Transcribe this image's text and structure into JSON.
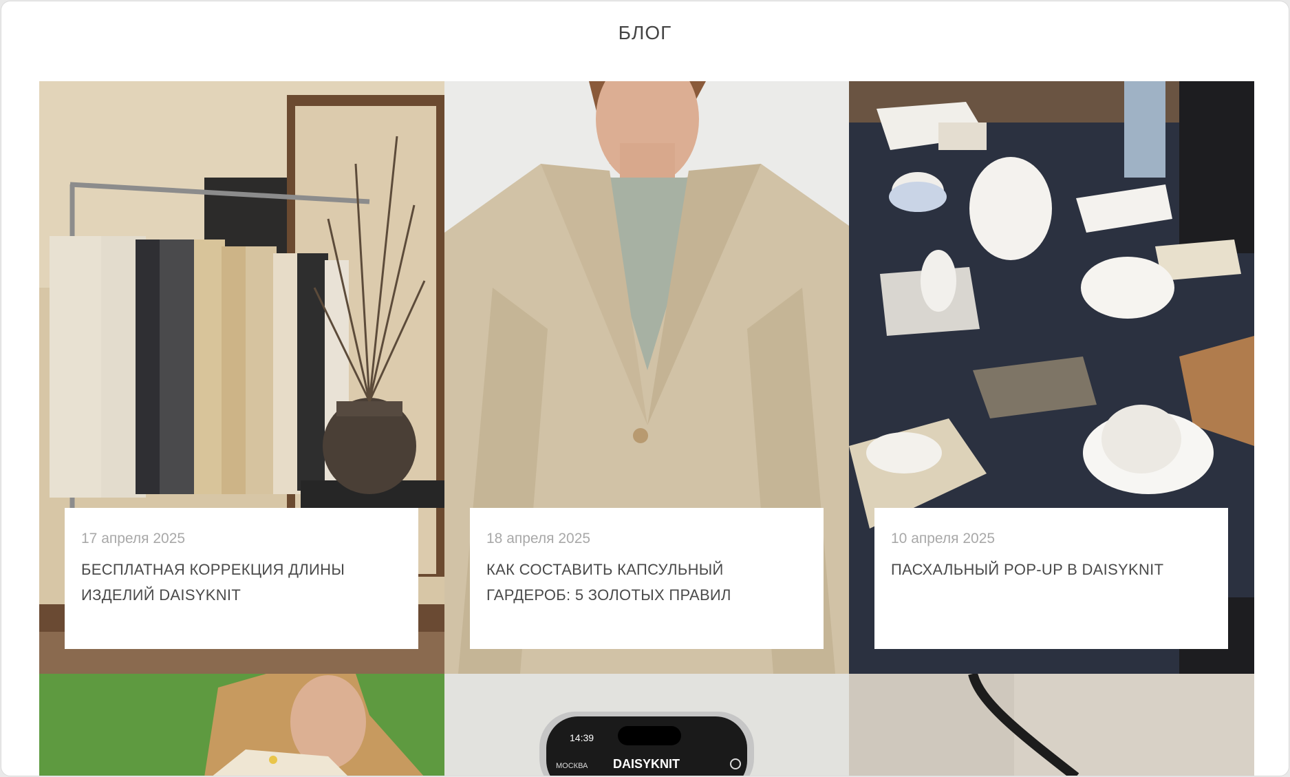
{
  "page": {
    "title": "БЛОГ"
  },
  "posts": [
    {
      "date": "17 апреля 2025",
      "title": "БЕСПЛАТНАЯ КОРРЕКЦИЯ ДЛИНЫ ИЗДЕЛИЙ DAISYKNIT",
      "image": "showroom-clothing-rack"
    },
    {
      "date": "18 апреля 2025",
      "title": "КАК СОСТАВИТЬ КАПСУЛЬНЫЙ ГАРДЕРОБ: 5 ЗОЛОТЫХ ПРАВИЛ",
      "image": "woman-beige-blazer"
    },
    {
      "date": "10 апреля 2025",
      "title": "ПАСХАЛЬНЫЙ POP-UP В DAISYKNIT",
      "image": "ceramics-table"
    }
  ],
  "next_row": {
    "phone": {
      "time": "14:39",
      "location": "МОСКВА",
      "brand": "DAISYKNIT"
    }
  }
}
